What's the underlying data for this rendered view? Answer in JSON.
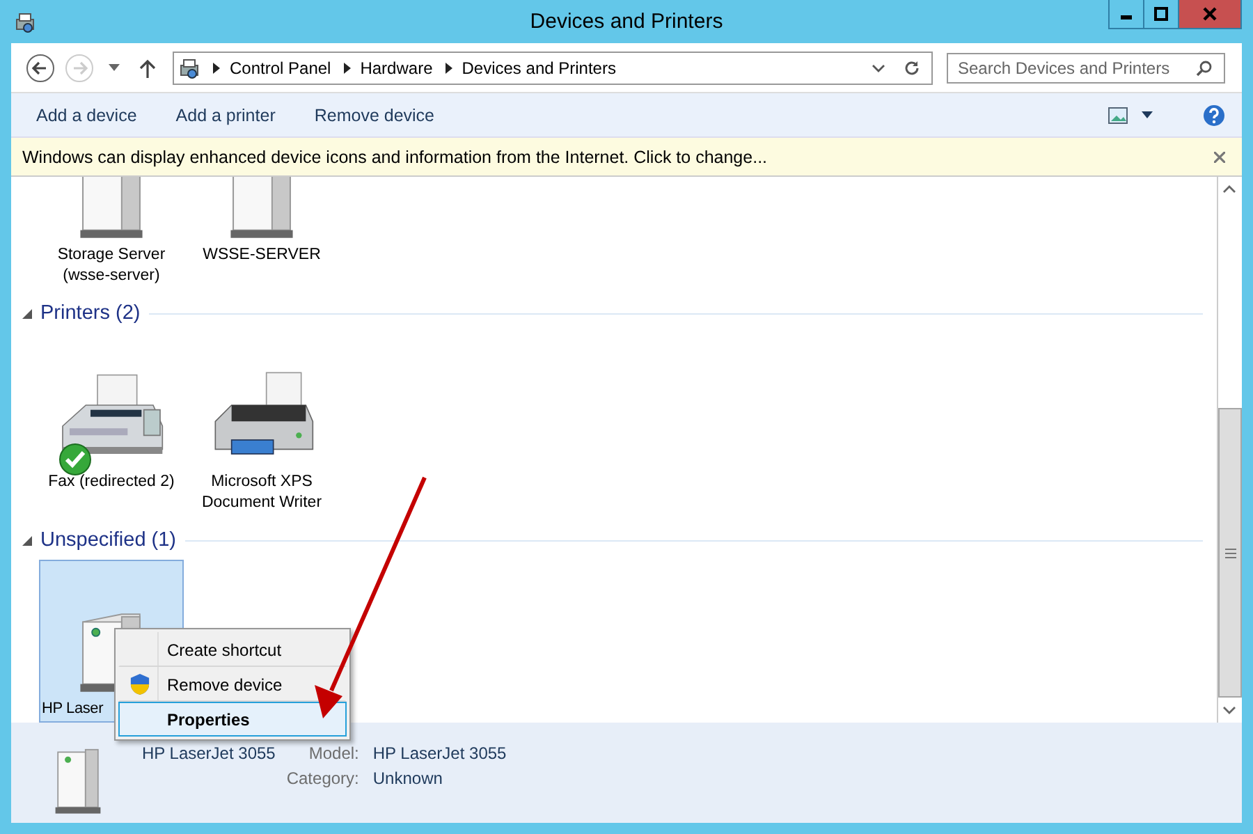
{
  "window": {
    "title": "Devices and Printers"
  },
  "address_bar": {
    "breadcrumbs": [
      "Control Panel",
      "Hardware",
      "Devices and Printers"
    ]
  },
  "search": {
    "placeholder": "Search Devices and Printers"
  },
  "command_bar": {
    "buttons": [
      "Add a device",
      "Add a printer",
      "Remove device"
    ]
  },
  "info_bar": {
    "text": "Windows can display enhanced device icons and information from the Internet. Click to change..."
  },
  "groups": [
    {
      "devices": [
        {
          "kind": "server",
          "label": "Storage Server (wsse-server)",
          "selected": false,
          "default": false
        },
        {
          "kind": "server",
          "label": "WSSE-SERVER",
          "selected": false,
          "default": false
        }
      ]
    },
    {
      "title": "Printers (2)",
      "devices": [
        {
          "kind": "fax",
          "label": "Fax (redirected 2)",
          "selected": false,
          "default": true
        },
        {
          "kind": "printer",
          "label": "Microsoft XPS Document Writer",
          "selected": false,
          "default": false
        }
      ]
    },
    {
      "title": "Unspecified (1)",
      "devices": [
        {
          "kind": "device",
          "label": "HP Laser",
          "selected": true,
          "default": false
        }
      ]
    }
  ],
  "context_menu": [
    {
      "kind": "plain",
      "label": "Create shortcut",
      "selected": false,
      "default": false
    },
    {
      "kind": "elevated",
      "label": "Remove device",
      "selected": false,
      "default": false
    },
    {
      "kind": "plain",
      "label": "Properties",
      "selected": true,
      "default": true
    }
  ],
  "details": {
    "name": "HP LaserJet 3055",
    "fields": [
      {
        "label": "Model:",
        "value": "HP LaserJet 3055"
      },
      {
        "label": "Category:",
        "value": "Unknown"
      }
    ]
  }
}
